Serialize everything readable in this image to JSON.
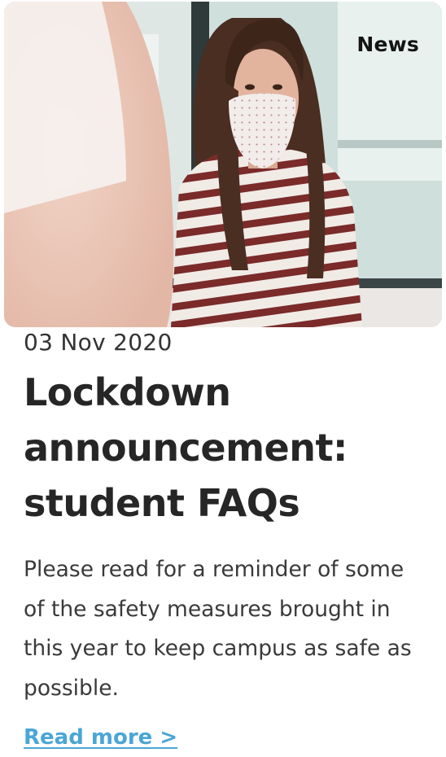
{
  "article": {
    "tag": "News",
    "date": "03 Nov 2020",
    "title": "Lockdown announcement: student FAQs",
    "summary": "Please read for a reminder of some of the safety measures brought in this year to keep campus as safe as possible.",
    "read_more": "Read more >"
  },
  "colors": {
    "link": "#4aa6d6",
    "text": "#2b2b2b"
  }
}
